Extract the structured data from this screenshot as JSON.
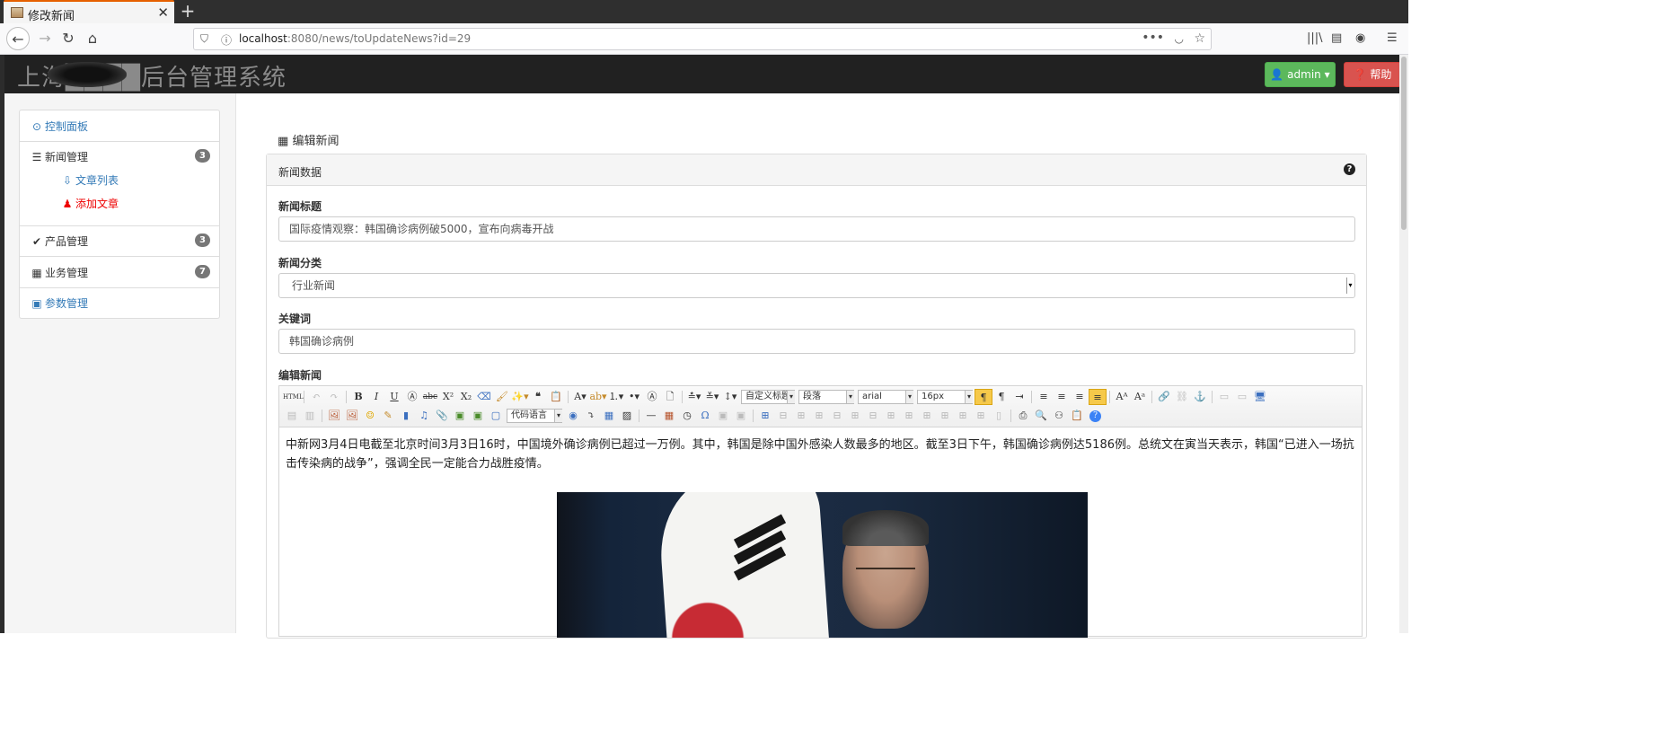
{
  "browser": {
    "tab_title": "修改新闻",
    "url_host": "localhost",
    "url_path": ":8080/news/toUpdateNews?id=29"
  },
  "header": {
    "brand": "上海████后台管理系统",
    "admin_label": "admin",
    "help_label": "帮助",
    "colors": {
      "admin": "#5cb85c",
      "help": "#d9534f",
      "bar": "#212121"
    }
  },
  "sidebar": {
    "dashboard": "控制面板",
    "news": {
      "label": "新闻管理",
      "badge": "3"
    },
    "article_list": "文章列表",
    "add_article": "添加文章",
    "product": {
      "label": "产品管理",
      "badge": "3"
    },
    "business": {
      "label": "业务管理",
      "badge": "7"
    },
    "params": "参数管理"
  },
  "main": {
    "heading": "编辑新闻",
    "panel_title": "新闻数据",
    "title_label": "新闻标题",
    "title_value": "国际疫情观察：韩国确诊病例破5000，宣布向病毒开战",
    "category_label": "新闻分类",
    "category_value": "行业新闻",
    "keywords_label": "关键词",
    "keywords_value": "韩国确诊病例",
    "editor_label": "编辑新闻"
  },
  "editor": {
    "toolbar": {
      "custom_title": "自定义标题",
      "paragraph": "段落",
      "font_family": "arial",
      "font_size": "16px",
      "code_lang": "代码语言"
    },
    "content": "中新网3月4日电截至北京时间3月3日16时，中国境外确诊病例已超过一万例。其中，韩国是除中国外感染人数最多的地区。截至3日下午，韩国确诊病例达5186例。总统文在寅当天表示，韩国“已进入一场抗击传染病的战争”，强调全民一定能合力战胜疫情。"
  }
}
